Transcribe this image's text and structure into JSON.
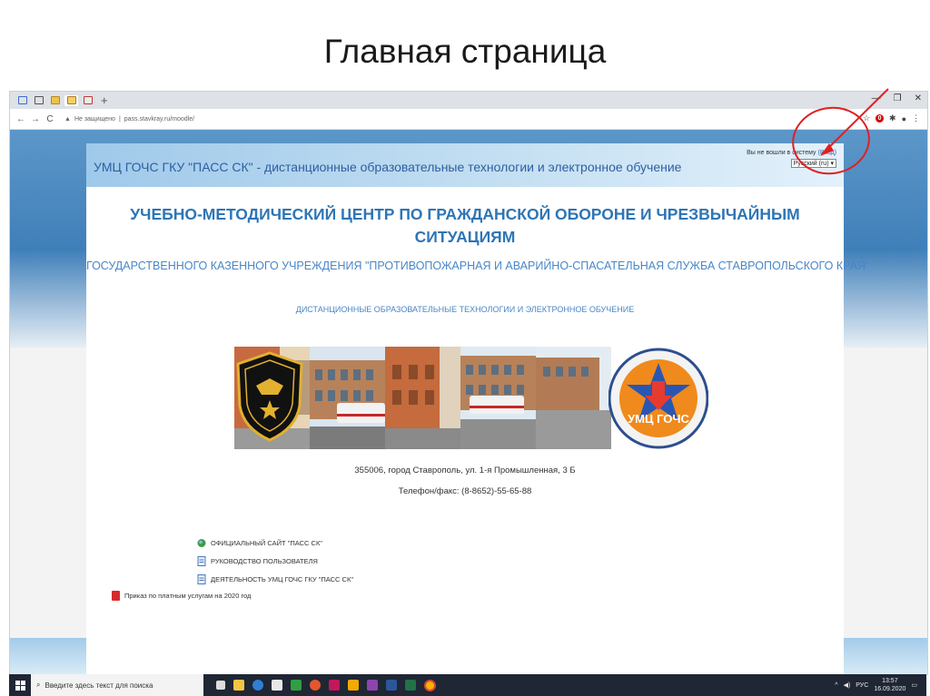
{
  "slide": {
    "title": "Главная страница"
  },
  "browser": {
    "address": {
      "security_label": "Не защищено",
      "url": "pass.stavkray.ru/moodle/"
    },
    "notification_count": "0"
  },
  "site": {
    "header_title": "УМЦ ГОЧС ГКУ \"ПАСС СК\" - дистанционные образовательные технологии и электронное обучение",
    "login_text": "Вы не вошли в систему",
    "login_link": "(Вход)",
    "language_selected": "Русский (ru)",
    "main_heading": "УЧЕБНО-МЕТОДИЧЕСКИЙ ЦЕНТР ПО ГРАЖДАНСКОЙ ОБОРОНЕ И ЧРЕЗВЫЧАЙНЫМ СИТУАЦИЯМ",
    "sub_heading": "ГОСУДАРСТВЕННОГО КАЗЕННОГО УЧРЕЖДЕНИЯ \"ПРОТИВОПОЖАРНАЯ И АВАРИЙНО-СПАСАТЕЛЬНАЯ СЛУЖБА СТАВРОПОЛЬСКОГО КРАЯ\"",
    "tagline": "ДИСТАНЦИОННЫЕ ОБРАЗОВАТЕЛЬНЫЕ ТЕХНОЛОГИИ И ЭЛЕКТРОННОЕ ОБУЧЕНИЕ",
    "emblem_right_text": "УМЦ ГОЧС",
    "address": "355006, город Ставрополь, ул. 1-я Промышленная, 3 Б",
    "phone": "Телефон/факс:   (8-8652)-55-65-88",
    "links": [
      {
        "label": "ОФИЦИАЛЬНЫЙ САЙТ \"ПАСС СК\"",
        "icon": "globe-icon"
      },
      {
        "label": "РУКОВОДСТВО ПОЛЬЗОВАТЕЛЯ",
        "icon": "document-icon"
      },
      {
        "label": "ДЕЯТЕЛЬНОСТЬ УМЦ ГОЧС ГКУ \"ПАСС СК\"",
        "icon": "document-icon"
      }
    ],
    "order_link": "Приказ по платным услугам на 2020 год"
  },
  "taskbar": {
    "search_placeholder": "Введите здесь текст для поиска",
    "language": "РУС",
    "time": "13:57",
    "date": "16.09.2020"
  },
  "colors": {
    "accent_blue": "#2e75b6",
    "annotation_red": "#e02020"
  }
}
